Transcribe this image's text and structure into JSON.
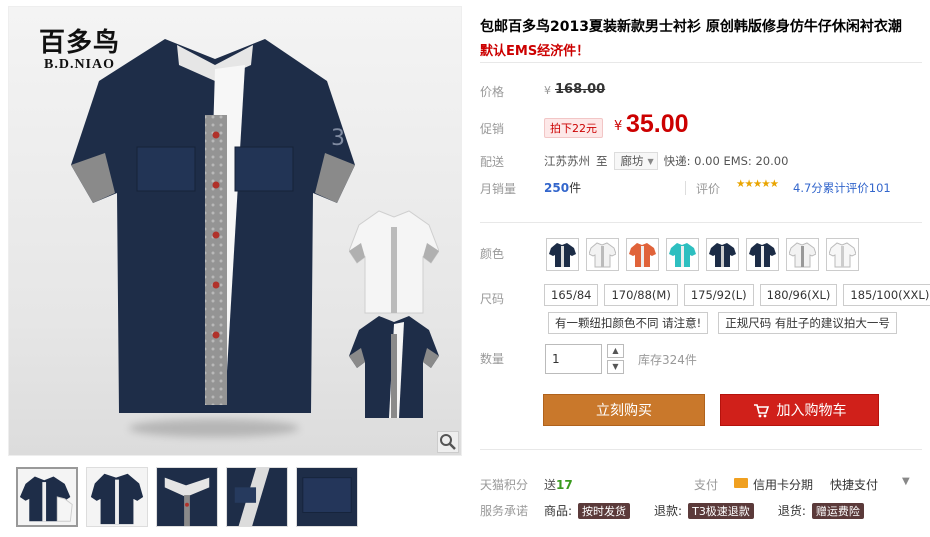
{
  "brand": {
    "cn": "百多鸟",
    "en": "B.D.NIAO"
  },
  "product": {
    "title": "包邮百多鸟2013夏装新款男士衬衫 原创韩版修身仿牛仔休闲衬衣潮",
    "subtitle": "默认EMS经济件！"
  },
  "price": {
    "label": "价格",
    "currency": "¥",
    "original": "168.00"
  },
  "promo": {
    "label": "促销",
    "tag": "拍下22元",
    "currency": "¥",
    "price": "35.00"
  },
  "shipping": {
    "label": "配送",
    "from": "江苏苏州",
    "to_word": "至",
    "destination": "廊坊",
    "fees": "快递: 0.00 EMS: 20.00"
  },
  "sales": {
    "label": "月销量",
    "count": "250",
    "unit": "件",
    "review_label": "评价",
    "stars": "★★★★★",
    "rating_text": "4.7分累计评价101"
  },
  "options": {
    "color_label": "颜色",
    "colors": [
      {
        "name": "navy",
        "hex": "#1c2c46"
      },
      {
        "name": "white",
        "hex": "#f2f2f2"
      },
      {
        "name": "orange",
        "hex": "#e0633a"
      },
      {
        "name": "teal",
        "hex": "#2ebfc0"
      },
      {
        "name": "navy",
        "hex": "#1c2c46"
      },
      {
        "name": "navy",
        "hex": "#1c2c46"
      },
      {
        "name": "white",
        "hex": "#f2f2f2"
      },
      {
        "name": "white",
        "hex": "#f2f2f2"
      }
    ],
    "size_label": "尺码",
    "sizes": [
      "165/84",
      "170/88(M)",
      "175/92(L)",
      "180/96(XL)",
      "185/100(XXL)"
    ],
    "notes": [
      "有一颗纽扣颜色不同 请注意!",
      "正规尺码 有肚子的建议拍大一号"
    ]
  },
  "quantity": {
    "label": "数量",
    "value": "1",
    "up": "▲",
    "down": "▼",
    "stock": "库存324件"
  },
  "actions": {
    "buy": "立刻购买",
    "cart": "加入购物车"
  },
  "tmall": {
    "points_label": "天猫积分",
    "points_prefix": "送",
    "points_value": "17",
    "pay_label": "支付",
    "installment": "信用卡分期",
    "quickpay": "快捷支付",
    "quickpay_arrow": "▼",
    "service_label": "服务承诺",
    "services": [
      {
        "prefix": "商品:",
        "tag": "按时发货"
      },
      {
        "prefix": "退款:",
        "tag": "T3极速退款"
      },
      {
        "prefix": "退货:",
        "tag": "赠运费险"
      }
    ]
  },
  "colors_theme": {
    "price_red": "#cc0000",
    "buy_orange": "#c9782b",
    "cart_red": "#d0201a",
    "link_blue": "#3366cc"
  }
}
